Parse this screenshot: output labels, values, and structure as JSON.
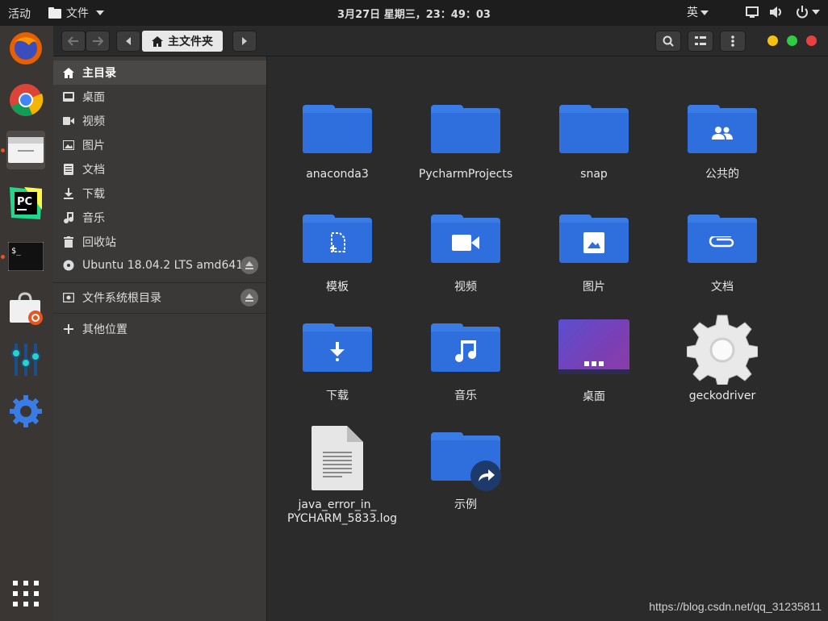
{
  "topbar": {
    "activities": "活动",
    "app_name": "文件",
    "clock": "3月27日 星期三，23：49：03",
    "input_method": "英"
  },
  "headerbar": {
    "path_label": "主文件夹"
  },
  "sidebar": {
    "items": [
      {
        "label": "主目录"
      },
      {
        "label": "桌面"
      },
      {
        "label": "视频"
      },
      {
        "label": "图片"
      },
      {
        "label": "文档"
      },
      {
        "label": "下载"
      },
      {
        "label": "音乐"
      },
      {
        "label": "回收站"
      },
      {
        "label": "Ubuntu 18.04.2 LTS amd641"
      },
      {
        "label": "文件系统根目录"
      },
      {
        "label": "其他位置"
      }
    ]
  },
  "files": [
    {
      "label": "anaconda3"
    },
    {
      "label": "PycharmProjects"
    },
    {
      "label": "snap"
    },
    {
      "label": "公共的"
    },
    {
      "label": "模板"
    },
    {
      "label": "视频"
    },
    {
      "label": "图片"
    },
    {
      "label": "文档"
    },
    {
      "label": "下载"
    },
    {
      "label": "音乐"
    },
    {
      "label": "桌面"
    },
    {
      "label": "geckodriver"
    },
    {
      "label": "java_error_in_ PYCHARM_5833.log"
    },
    {
      "label": "示例"
    }
  ],
  "watermark": "https://blog.csdn.net/qq_31235811",
  "colors": {
    "folder": "#2f6fdd",
    "accent_orange": "#e95420",
    "window_yellow": "#f4c20d",
    "window_green": "#2ecc40",
    "window_red": "#e94040"
  }
}
